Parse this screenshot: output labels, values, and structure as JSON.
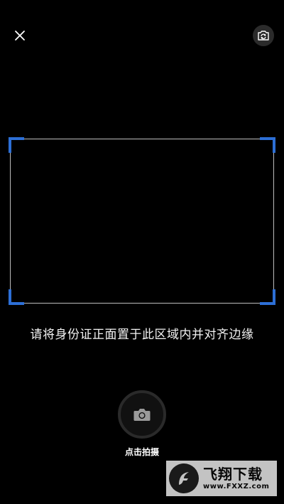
{
  "top_bar": {
    "close_icon": "close-icon",
    "switch_camera_icon": "switch-camera-icon"
  },
  "capture": {
    "hint": "请将身份证正面置于此区域内并对齐边缘",
    "shutter_label": "点击拍摄",
    "frame_color": "#bdbdbd",
    "corner_color": "#2d6fd6"
  },
  "watermark": {
    "title": "飞翔下载",
    "url": "www.FXXZ.com"
  }
}
